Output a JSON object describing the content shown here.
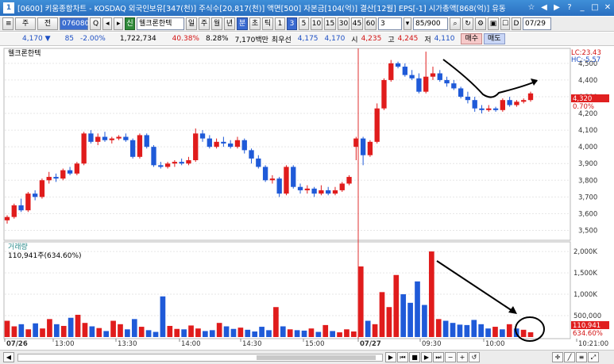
{
  "window": {
    "icon": "1",
    "title": "[0600] 키움종합차트 - KOSDAQ 외국인보유[347(천)] 주식수[20,817(천)] 액면[500] 자본금[104(억)] 결산[12월] EPS[-1] 시가총액[868(억)] 유동",
    "controls": [
      "☆",
      "◀",
      "▶",
      "?",
      "_",
      "□",
      "✕"
    ]
  },
  "toolbar": {
    "type_value": "주",
    "jeon_label": "전",
    "stock_code": "076080",
    "search_label": "Q",
    "credit_label": "신",
    "stock_name": "웰크론한텍",
    "periods": [
      "일",
      "주",
      "월",
      "년",
      "분",
      "초",
      "틱"
    ],
    "selected_period": "분",
    "intervals": [
      "1",
      "3",
      "5",
      "10",
      "15",
      "30",
      "45",
      "60"
    ],
    "selected_interval": "3",
    "interval_value": "3",
    "count_value": "85/900",
    "date_value": "07/29"
  },
  "quote": {
    "price": "4,170 ▼",
    "change": "85",
    "change_pct": "-2.00%",
    "volume": "1,722,734",
    "vol_ratio": "40.38%",
    "turnover": "8.28%",
    "amount": "7,170백만",
    "best_sell_label": "최우선",
    "best_sell": "4,175",
    "best_buy": "4,170",
    "open_label": "시",
    "open": "4,235",
    "high_label": "고",
    "high": "4,245",
    "low_label": "저",
    "low": "4,110",
    "buy_button": "매수",
    "sell_button": "매도"
  },
  "chart_data": {
    "type": "candlestick",
    "title": "웰크론한텍",
    "price_axis": [
      "4,500",
      "4,400",
      "4,300",
      "4,200",
      "4,100",
      "4,000",
      "3,900",
      "3,800",
      "3,700",
      "3,600",
      "3,500"
    ],
    "ylim": [
      3450,
      4580
    ],
    "lc_label": "LC:23.43",
    "hc_label": "HC:-5.57",
    "current_price_tag": "4,320",
    "current_pct_tag": "0.70%",
    "x_labels": [
      "07/26",
      "13:00",
      "13:30",
      "14:00",
      "14:30",
      "15:00",
      "07/27",
      "09:30",
      "10:00",
      "10:21:00"
    ],
    "candles": [
      {
        "o": 3560,
        "c": 3580,
        "h": 3590,
        "l": 3540
      },
      {
        "o": 3580,
        "c": 3650,
        "h": 3660,
        "l": 3570
      },
      {
        "o": 3650,
        "c": 3620,
        "h": 3690,
        "l": 3610
      },
      {
        "o": 3620,
        "c": 3720,
        "h": 3730,
        "l": 3610
      },
      {
        "o": 3720,
        "c": 3700,
        "h": 3740,
        "l": 3680
      },
      {
        "o": 3700,
        "c": 3800,
        "h": 3810,
        "l": 3690
      },
      {
        "o": 3800,
        "c": 3820,
        "h": 3850,
        "l": 3780
      },
      {
        "o": 3820,
        "c": 3810,
        "h": 3840,
        "l": 3790
      },
      {
        "o": 3810,
        "c": 3860,
        "h": 3870,
        "l": 3800
      },
      {
        "o": 3860,
        "c": 3840,
        "h": 3880,
        "l": 3830
      },
      {
        "o": 3840,
        "c": 3900,
        "h": 3910,
        "l": 3830
      },
      {
        "o": 3900,
        "c": 4080,
        "h": 4090,
        "l": 3890
      },
      {
        "o": 4080,
        "c": 4030,
        "h": 4100,
        "l": 4020
      },
      {
        "o": 4030,
        "c": 4060,
        "h": 4080,
        "l": 4010
      },
      {
        "o": 4060,
        "c": 4040,
        "h": 4090,
        "l": 4030
      },
      {
        "o": 4040,
        "c": 4050,
        "h": 4060,
        "l": 4020
      },
      {
        "o": 4050,
        "c": 4060,
        "h": 4070,
        "l": 4040
      },
      {
        "o": 4060,
        "c": 4040,
        "h": 4080,
        "l": 4030
      },
      {
        "o": 4040,
        "c": 3940,
        "h": 4050,
        "l": 3930
      },
      {
        "o": 3940,
        "c": 4070,
        "h": 4080,
        "l": 3930
      },
      {
        "o": 4070,
        "c": 4000,
        "h": 4080,
        "l": 3990
      },
      {
        "o": 4000,
        "c": 3890,
        "h": 4010,
        "l": 3880
      },
      {
        "o": 3890,
        "c": 3880,
        "h": 3910,
        "l": 3870
      },
      {
        "o": 3880,
        "c": 3900,
        "h": 3910,
        "l": 3870
      },
      {
        "o": 3900,
        "c": 3910,
        "h": 3920,
        "l": 3880
      },
      {
        "o": 3910,
        "c": 3900,
        "h": 3930,
        "l": 3890
      },
      {
        "o": 3900,
        "c": 3920,
        "h": 3940,
        "l": 3890
      },
      {
        "o": 3920,
        "c": 4080,
        "h": 4110,
        "l": 3910
      },
      {
        "o": 4080,
        "c": 4050,
        "h": 4100,
        "l": 4030
      },
      {
        "o": 4050,
        "c": 4000,
        "h": 4070,
        "l": 3990
      },
      {
        "o": 4000,
        "c": 4030,
        "h": 4050,
        "l": 3990
      },
      {
        "o": 4030,
        "c": 4020,
        "h": 4060,
        "l": 4000
      },
      {
        "o": 4020,
        "c": 4000,
        "h": 4040,
        "l": 3990
      },
      {
        "o": 4000,
        "c": 4040,
        "h": 4060,
        "l": 3990
      },
      {
        "o": 4040,
        "c": 3980,
        "h": 4050,
        "l": 3960
      },
      {
        "o": 3980,
        "c": 3930,
        "h": 3990,
        "l": 3900
      },
      {
        "o": 3930,
        "c": 3880,
        "h": 3950,
        "l": 3870
      },
      {
        "o": 3880,
        "c": 3800,
        "h": 3890,
        "l": 3790
      },
      {
        "o": 3800,
        "c": 3810,
        "h": 3830,
        "l": 3780
      },
      {
        "o": 3810,
        "c": 3720,
        "h": 3820,
        "l": 3700
      },
      {
        "o": 3720,
        "c": 3880,
        "h": 3890,
        "l": 3710
      },
      {
        "o": 3880,
        "c": 3760,
        "h": 3890,
        "l": 3750
      },
      {
        "o": 3760,
        "c": 3740,
        "h": 3780,
        "l": 3720
      },
      {
        "o": 3740,
        "c": 3750,
        "h": 3770,
        "l": 3720
      },
      {
        "o": 3750,
        "c": 3720,
        "h": 3760,
        "l": 3700
      },
      {
        "o": 3720,
        "c": 3740,
        "h": 3770,
        "l": 3710
      },
      {
        "o": 3740,
        "c": 3720,
        "h": 3760,
        "l": 3710
      },
      {
        "o": 3720,
        "c": 3740,
        "h": 3760,
        "l": 3710
      },
      {
        "o": 3740,
        "c": 3780,
        "h": 3790,
        "l": 3730
      },
      {
        "o": 3780,
        "c": 3820,
        "h": 3830,
        "l": 3770
      },
      {
        "o": 4000,
        "c": 4050,
        "h": 4060,
        "l": 3920
      },
      {
        "o": 4050,
        "c": 3950,
        "h": 4060,
        "l": 3890
      },
      {
        "o": 3950,
        "c": 4030,
        "h": 4040,
        "l": 3940
      },
      {
        "o": 4030,
        "c": 4230,
        "h": 4260,
        "l": 4020
      },
      {
        "o": 4230,
        "c": 4400,
        "h": 4410,
        "l": 4220
      },
      {
        "o": 4400,
        "c": 4500,
        "h": 4520,
        "l": 4390
      },
      {
        "o": 4500,
        "c": 4480,
        "h": 4510,
        "l": 4470
      },
      {
        "o": 4480,
        "c": 4430,
        "h": 4500,
        "l": 4420
      },
      {
        "o": 4430,
        "c": 4410,
        "h": 4460,
        "l": 4400
      },
      {
        "o": 4410,
        "c": 4330,
        "h": 4440,
        "l": 4320
      },
      {
        "o": 4330,
        "c": 4420,
        "h": 4570,
        "l": 4320
      },
      {
        "o": 4420,
        "c": 4440,
        "h": 4480,
        "l": 4400
      },
      {
        "o": 4440,
        "c": 4400,
        "h": 4460,
        "l": 4390
      },
      {
        "o": 4400,
        "c": 4380,
        "h": 4420,
        "l": 4360
      },
      {
        "o": 4380,
        "c": 4350,
        "h": 4400,
        "l": 4340
      },
      {
        "o": 4350,
        "c": 4300,
        "h": 4360,
        "l": 4290
      },
      {
        "o": 4300,
        "c": 4280,
        "h": 4330,
        "l": 4260
      },
      {
        "o": 4280,
        "c": 4230,
        "h": 4300,
        "l": 4210
      },
      {
        "o": 4230,
        "c": 4220,
        "h": 4250,
        "l": 4200
      },
      {
        "o": 4220,
        "c": 4230,
        "h": 4250,
        "l": 4210
      },
      {
        "o": 4230,
        "c": 4220,
        "h": 4240,
        "l": 4210
      },
      {
        "o": 4220,
        "c": 4280,
        "h": 4290,
        "l": 4210
      },
      {
        "o": 4280,
        "c": 4250,
        "h": 4300,
        "l": 4240
      },
      {
        "o": 4250,
        "c": 4270,
        "h": 4280,
        "l": 4240
      },
      {
        "o": 4270,
        "c": 4280,
        "h": 4290,
        "l": 4260
      },
      {
        "o": 4280,
        "c": 4320,
        "h": 4330,
        "l": 4270
      }
    ],
    "volume": {
      "title": "거래량",
      "info": "110,941주(634.60%)",
      "axis": [
        "2,000K",
        "1,500K",
        "1,000K",
        "500,000"
      ],
      "ylim": [
        0,
        2150000
      ],
      "current_tag": "110,941",
      "current_pct_tag": "634.60%",
      "bars": [
        380000,
        250000,
        300000,
        180000,
        320000,
        200000,
        420000,
        300000,
        260000,
        450000,
        520000,
        330000,
        250000,
        210000,
        140000,
        380000,
        300000,
        180000,
        420000,
        240000,
        160000,
        120000,
        950000,
        260000,
        190000,
        180000,
        270000,
        200000,
        140000,
        160000,
        330000,
        250000,
        190000,
        220000,
        170000,
        130000,
        240000,
        160000,
        700000,
        250000,
        180000,
        160000,
        150000,
        200000,
        120000,
        280000,
        140000,
        110000,
        180000,
        130000,
        1650000,
        380000,
        300000,
        1050000,
        700000,
        1450000,
        1000000,
        800000,
        1300000,
        750000,
        2000000,
        420000,
        380000,
        330000,
        290000,
        280000,
        400000,
        300000,
        200000,
        240000,
        180000,
        300000,
        200000,
        170000,
        110941
      ]
    }
  }
}
